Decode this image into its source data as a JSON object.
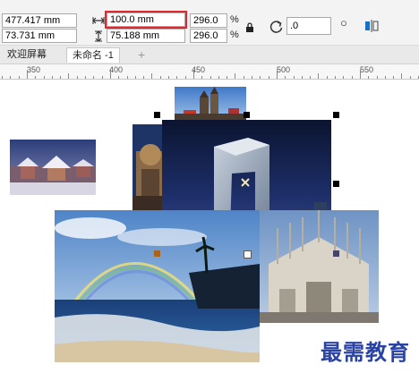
{
  "property_bar": {
    "x_value": "477.417 mm",
    "y_value": "73.731 mm",
    "width_value": "100.0 mm",
    "height_value": "75.188 mm",
    "scale_x": "296.0",
    "scale_y": "296.0",
    "percent": "%",
    "rotation_value": ".0",
    "degree_symbol": "°",
    "icons": [
      "width-arrows-icon",
      "height-arrows-icon",
      "lock-icon",
      "rotate-icon",
      "mirror-icon"
    ]
  },
  "tabs": [
    {
      "label": "欢迎屏幕",
      "active": false
    },
    {
      "label": "未命名 -1",
      "active": true
    },
    {
      "label": "+",
      "active": false
    }
  ],
  "ruler": {
    "labels": [
      "350",
      "400",
      "450",
      "500",
      "550"
    ]
  },
  "watermark": "最需教育",
  "colors": {
    "highlight": "#e0282e",
    "watermark": "#2a43a3"
  }
}
